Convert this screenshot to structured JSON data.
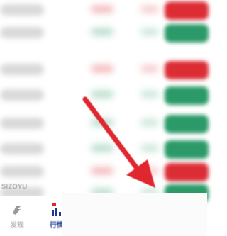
{
  "colors": {
    "up": "#dc2d35",
    "down": "#2b9a68",
    "arrow": "#e0262d",
    "nav_active": "#1a3c8f"
  },
  "list": {
    "rows": [
      {
        "trend": "up"
      },
      {
        "trend": "down"
      },
      {
        "trend": "up"
      },
      {
        "trend": "down"
      },
      {
        "trend": "down"
      },
      {
        "trend": "down"
      },
      {
        "trend": "up"
      },
      {
        "trend": "down"
      }
    ]
  },
  "footer": {
    "code": "SIZOYU"
  },
  "nav": {
    "items": [
      {
        "label": "发现",
        "icon": "discover-icon",
        "active": false
      },
      {
        "label": "行情",
        "icon": "market-chart-icon",
        "active": true
      }
    ]
  },
  "annotation": {
    "icon": "red-arrow-pointer-icon"
  }
}
